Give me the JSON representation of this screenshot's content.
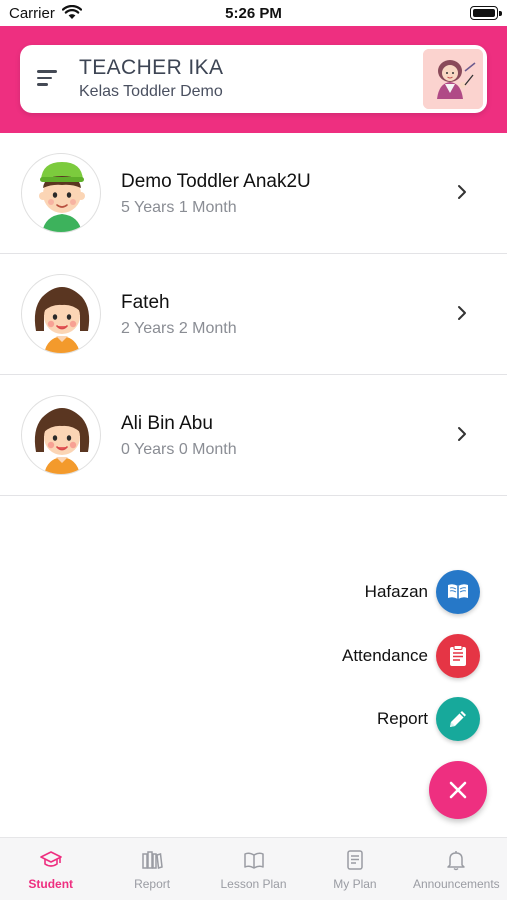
{
  "status_bar": {
    "carrier": "Carrier",
    "time": "5:26 PM"
  },
  "header": {
    "teacher_name": "TEACHER IKA",
    "class_name": "Kelas Toddler Demo"
  },
  "students": [
    {
      "name": "Demo Toddler Anak2U",
      "age": "5 Years 1 Month",
      "avatar": "boy-cap-avatar"
    },
    {
      "name": "Fateh",
      "age": "2 Years 2 Month",
      "avatar": "girl-avatar"
    },
    {
      "name": "Ali Bin Abu",
      "age": "0 Years 0 Month",
      "avatar": "girl-avatar"
    }
  ],
  "fab_menu": {
    "items": [
      {
        "label": "Hafazan",
        "icon": "book-icon",
        "color": "#2678c8"
      },
      {
        "label": "Attendance",
        "icon": "clipboard-icon",
        "color": "#e53545"
      },
      {
        "label": "Report",
        "icon": "pencil-icon",
        "color": "#17a99b"
      }
    ],
    "close_icon": "close-icon",
    "main_color": "#ee2f80"
  },
  "bottom_nav": {
    "items": [
      {
        "label": "Student",
        "icon": "graduation-cap-icon",
        "active": true
      },
      {
        "label": "Report",
        "icon": "books-icon",
        "active": false
      },
      {
        "label": "Lesson Plan",
        "icon": "open-book-icon",
        "active": false
      },
      {
        "label": "My Plan",
        "icon": "document-icon",
        "active": false
      },
      {
        "label": "Announcements",
        "icon": "bell-icon",
        "active": false
      }
    ]
  },
  "colors": {
    "brand": "#ee2f80",
    "muted_text": "#8a8d94"
  }
}
